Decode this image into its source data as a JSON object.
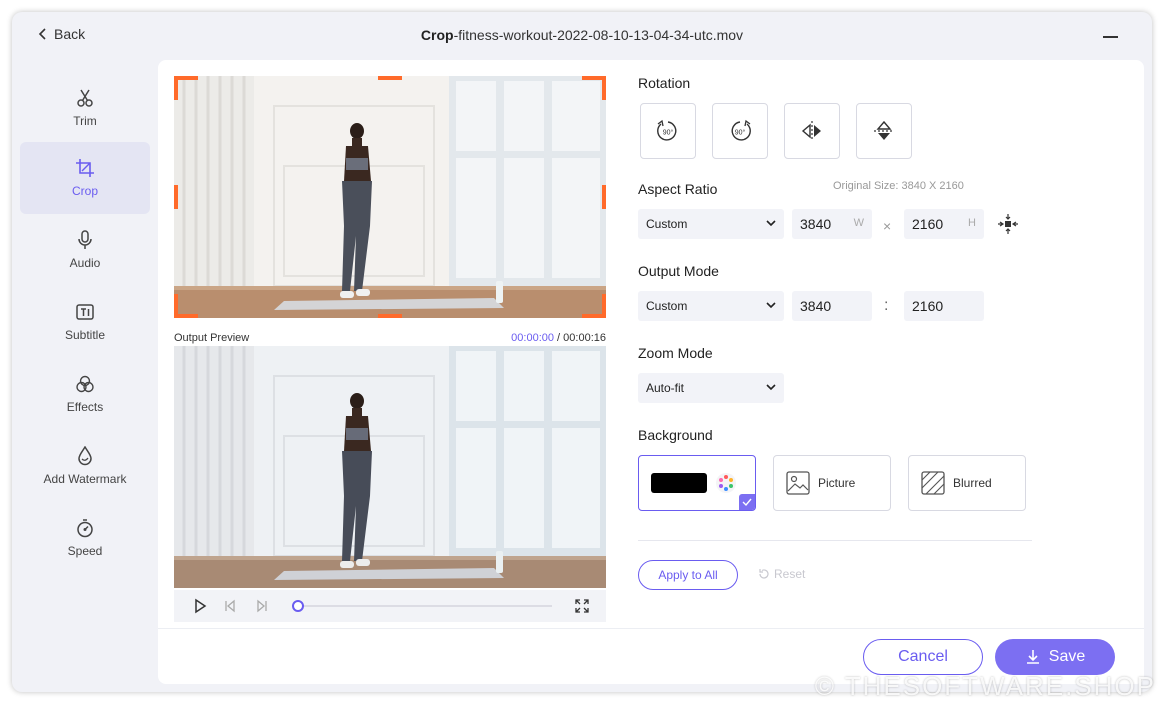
{
  "window": {
    "back_label": "Back",
    "title_bold": "Crop",
    "title_rest": "-fitness-workout-2022-08-10-13-04-34-utc.mov"
  },
  "sidebar": {
    "items": [
      {
        "label": "Trim",
        "icon": "scissors-icon"
      },
      {
        "label": "Crop",
        "icon": "crop-icon",
        "active": true
      },
      {
        "label": "Audio",
        "icon": "microphone-icon"
      },
      {
        "label": "Subtitle",
        "icon": "subtitle-icon"
      },
      {
        "label": "Effects",
        "icon": "effects-icon"
      },
      {
        "label": "Add Watermark",
        "icon": "watermark-icon"
      },
      {
        "label": "Speed",
        "icon": "speed-icon"
      }
    ]
  },
  "preview": {
    "output_label": "Output Preview",
    "current_time": "00:00:00",
    "separator": " / ",
    "total_time": "00:00:16",
    "progress": 0
  },
  "panel": {
    "rotation_label": "Rotation",
    "rotate_left_text": "90°",
    "rotate_right_text": "90°",
    "aspect_label": "Aspect Ratio",
    "original_size": "Original Size: 3840 X 2160",
    "aspect_select": "Custom",
    "width_value": "3840",
    "width_unit": "W",
    "height_value": "2160",
    "height_unit": "H",
    "times_symbol": "×",
    "output_label": "Output Mode",
    "output_select": "Custom",
    "output_width": "3840",
    "output_colon": ":",
    "output_height": "2160",
    "zoom_label": "Zoom Mode",
    "zoom_select": "Auto-fit",
    "background_label": "Background",
    "bg_picture": "Picture",
    "bg_blurred": "Blurred",
    "apply_label": "Apply to All",
    "reset_label": "Reset"
  },
  "footer": {
    "cancel_label": "Cancel",
    "save_label": "Save"
  },
  "watermark_text": "© THESOFTWARE.SHOP",
  "colors": {
    "accent": "#7c6ff2",
    "crop_corner": "#ff6a2a",
    "swatch": "#000000"
  }
}
